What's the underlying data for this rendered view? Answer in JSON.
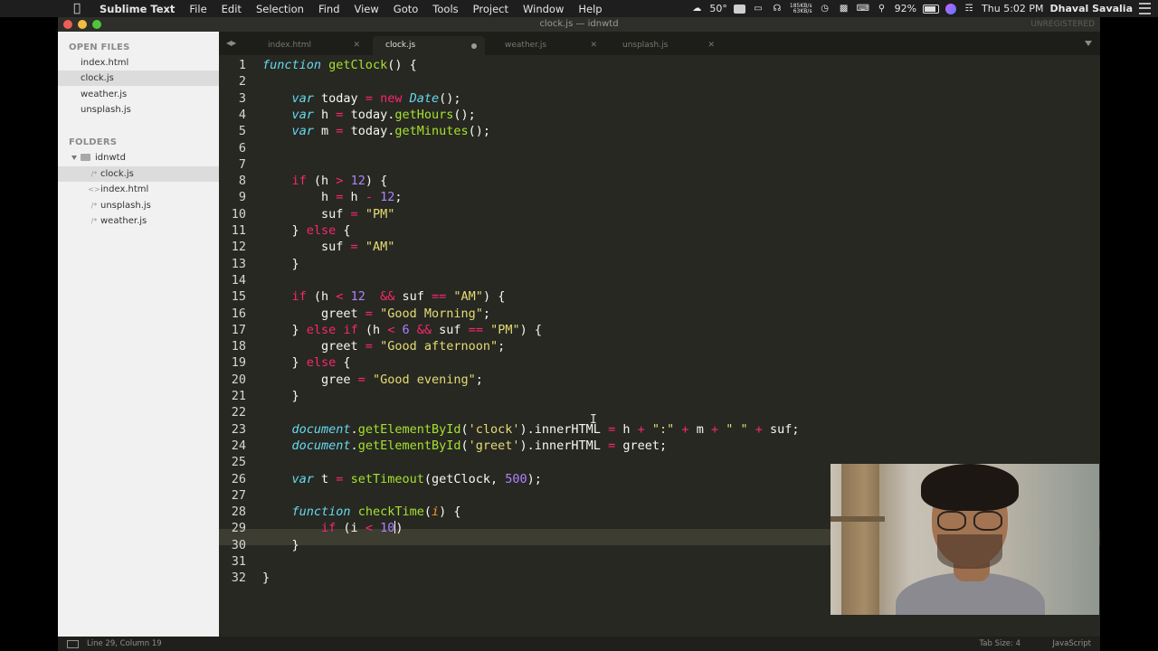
{
  "menubar": {
    "app_name": "Sublime Text",
    "items": [
      "File",
      "Edit",
      "Selection",
      "Find",
      "View",
      "Goto",
      "Tools",
      "Project",
      "Window",
      "Help"
    ],
    "temperature": "50°",
    "net_up": "185KB/s",
    "net_down": "63KB/s",
    "battery": "92%",
    "clock": "Thu 5:02 PM",
    "user": "Dhaval Savalia"
  },
  "window": {
    "title": "clock.js — idnwtd",
    "registration": "UNREGISTERED"
  },
  "sidebar": {
    "open_files_header": "OPEN FILES",
    "open_files": [
      "index.html",
      "clock.js",
      "weather.js",
      "unsplash.js"
    ],
    "active_open_file": "clock.js",
    "folders_header": "FOLDERS",
    "folder_name": "idnwtd",
    "folder_files": [
      {
        "name": "clock.js",
        "icon": "js-file-icon"
      },
      {
        "name": "index.html",
        "icon": "html-file-icon"
      },
      {
        "name": "unsplash.js",
        "icon": "js-file-icon"
      },
      {
        "name": "weather.js",
        "icon": "js-file-icon"
      }
    ]
  },
  "tabs": [
    {
      "label": "index.html",
      "state": "close"
    },
    {
      "label": "clock.js",
      "state": "dirty",
      "active": true
    },
    {
      "label": "weather.js",
      "state": "close"
    },
    {
      "label": "unsplash.js",
      "state": "close"
    }
  ],
  "editor": {
    "current_line": 29,
    "lines": [
      "function getClock() {",
      "",
      "    var today = new Date();",
      "    var h = today.getHours();",
      "    var m = today.getMinutes();",
      "",
      "",
      "    if (h > 12) {",
      "        h = h - 12;",
      "        suf = \"PM\"",
      "    } else {",
      "        suf = \"AM\"",
      "    }",
      "",
      "    if (h < 12  && suf == \"AM\") {",
      "        greet = \"Good Morning\";",
      "    } else if (h < 6 && suf == \"PM\") {",
      "        greet = \"Good afternoon\";",
      "    } else {",
      "        gree = \"Good evening\";",
      "    }",
      "",
      "    document.getElementById('clock').innerHTML = h + \":\" + m + \" \" + suf;",
      "    document.getElementById('greet').innerHTML = greet;",
      "",
      "    var t = setTimeout(getClock, 500);",
      "",
      "    function checkTime(i) {",
      "        if (i < 10)",
      "    }",
      "",
      "}"
    ]
  },
  "statusbar": {
    "position": "Line 29, Column 19",
    "tab_size": "Tab Size: 4",
    "syntax": "JavaScript"
  },
  "icons": {
    "apple": "apple-logo-icon",
    "wifi": "wifi-icon",
    "search": "spotlight-search-icon",
    "siri": "siri-icon",
    "notifications": "notification-center-icon"
  }
}
